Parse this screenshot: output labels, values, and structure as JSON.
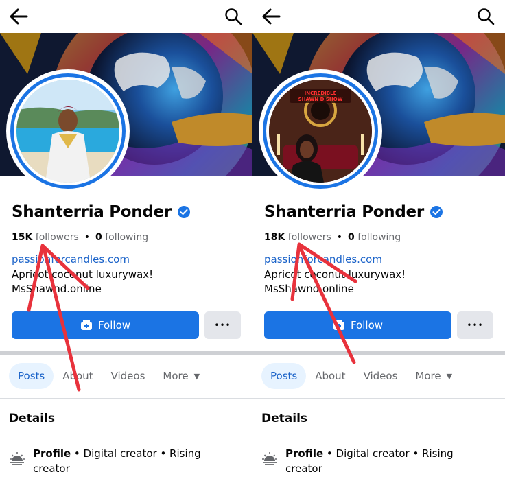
{
  "panels": [
    {
      "id": "left",
      "profile": {
        "name": "Shanterria Ponder",
        "followers_count": "15K",
        "followers_label": "followers",
        "separator": "•",
        "following_count": "0",
        "following_label": "following",
        "link": "passionforcandles.com",
        "bio_line1": "Apricot coconut luxurywax!",
        "bio_line2": "MsShawnd.online"
      }
    },
    {
      "id": "right",
      "profile": {
        "name": "Shanterria Ponder",
        "followers_count": "18K",
        "followers_label": "followers",
        "separator": "•",
        "following_count": "0",
        "following_label": "following",
        "link": "passionforcandles.com",
        "bio_line1": "Apricot coconut luxurywax!",
        "bio_line2": "MsShawnd.online"
      },
      "avatar_banner_text_line1": "INCREDIBLE",
      "avatar_banner_text_line2": "SHAWN D SHOW"
    }
  ],
  "actions": {
    "follow_label": "Follow",
    "more_label": "•••"
  },
  "tabs": [
    "Posts",
    "About",
    "Videos",
    "More"
  ],
  "details": {
    "title": "Details",
    "profile_label": "Profile",
    "profile_text": " • Digital creator • Rising creator"
  },
  "colors": {
    "accent": "#1b74e4",
    "link": "#1b63c9",
    "annotation_arrow": "#e8323c"
  },
  "icons": {
    "back": "arrow-left-icon",
    "search": "search-icon",
    "verified": "verified-badge-icon",
    "follow": "follow-user-icon",
    "profile": "sunrise-icon"
  }
}
